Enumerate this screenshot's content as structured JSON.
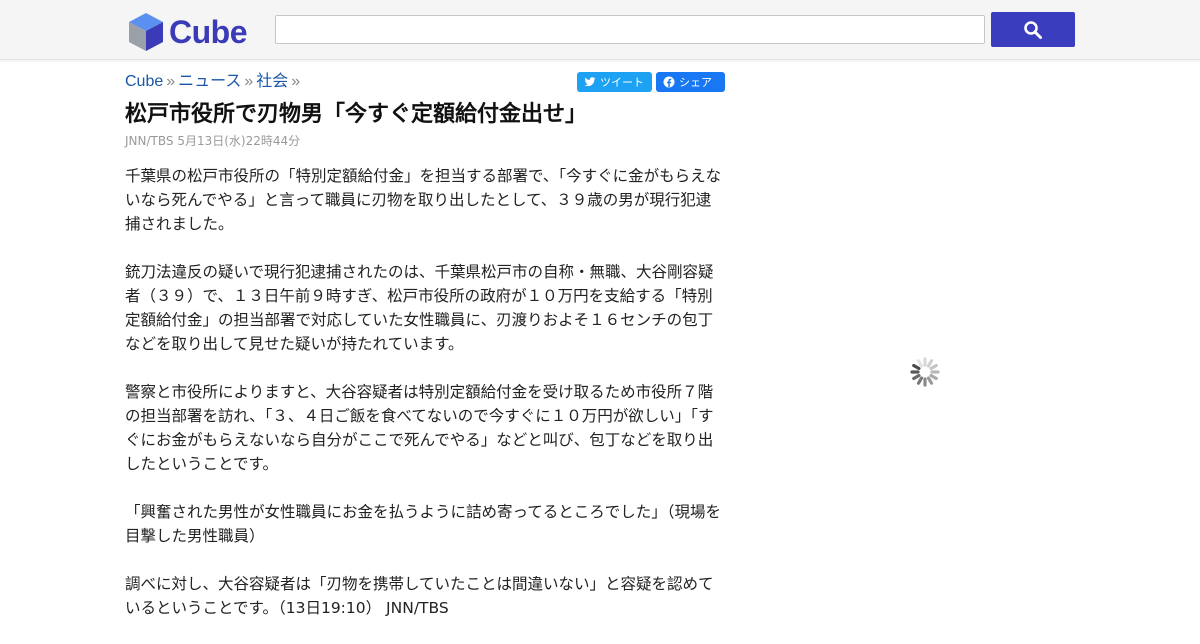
{
  "header": {
    "logo_text": "Cube",
    "search": {
      "value": "",
      "placeholder": ""
    }
  },
  "breadcrumb": {
    "items": [
      "Cube",
      "ニュース",
      "社会"
    ],
    "separator": "»"
  },
  "share": {
    "tweet_label": "ツイート",
    "share_label": "シェア"
  },
  "article": {
    "title": "松戸市役所で刃物男「今すぐ定額給付金出せ」",
    "meta": "JNN/TBS 5月13日(水)22時44分",
    "paragraphs": [
      "千葉県の松戸市役所の「特別定額給付金」を担当する部署で、「今すぐに金がもらえないなら死んでやる」と言って職員に刃物を取り出したとして、３９歳の男が現行犯逮捕されました。",
      "銃刀法違反の疑いで現行犯逮捕されたのは、千葉県松戸市の自称・無職、大谷剛容疑者（３９）で、１３日午前９時すぎ、松戸市役所の政府が１０万円を支給する「特別定額給付金」の担当部署で対応していた女性職員に、刃渡りおよそ１６センチの包丁などを取り出して見せた疑いが持たれています。",
      "警察と市役所によりますと、大谷容疑者は特別定額給付金を受け取るため市役所７階の担当部署を訪れ、「３、４日ご飯を食べてないので今すぐに１０万円が欲しい」「すぐにお金がもらえないなら自分がここで死んでやる」などと叫び、包丁などを取り出したということです。",
      "「興奮された男性が女性職員にお金を払うように詰め寄ってるところでした」（現場を目撃した男性職員）",
      "調べに対し、大谷容疑者は「刃物を携帯していたことは間違いない」と容疑を認めているということです。（13日19:10） JNN/TBS"
    ]
  },
  "icons": {
    "logo": "cube-logo-icon",
    "search": "search-icon",
    "twitter": "twitter-icon",
    "facebook": "facebook-icon",
    "loading": "loading-spinner-icon"
  },
  "colors": {
    "brand": "#3b3bb8",
    "search_button": "#3b3dbf",
    "link": "#1a57a8",
    "twitter": "#1da1f2",
    "facebook": "#1877f2"
  }
}
